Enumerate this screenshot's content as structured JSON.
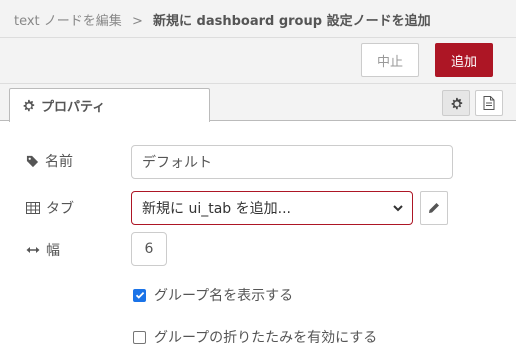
{
  "breadcrumb": {
    "parent": "text ノードを編集",
    "separator": ">",
    "current": "新規に dashboard group 設定ノードを追加"
  },
  "actions": {
    "cancel_label": "中止",
    "add_label": "追加"
  },
  "tabs": {
    "properties_label": "プロパティ",
    "icons": [
      "gear-icon",
      "document-icon"
    ]
  },
  "form": {
    "name_label": "名前",
    "name_value": "デフォルト",
    "tab_label": "タブ",
    "tab_selected": "新規に ui_tab を追加...",
    "width_label": "幅",
    "width_value": "6",
    "show_name_label": "グループ名を表示する",
    "show_name_checked": true,
    "collapse_label": "グループの折りたたみを有効にする",
    "collapse_checked": false
  },
  "colors": {
    "accent": "#ad1625",
    "checkbox": "#1a73e8"
  }
}
